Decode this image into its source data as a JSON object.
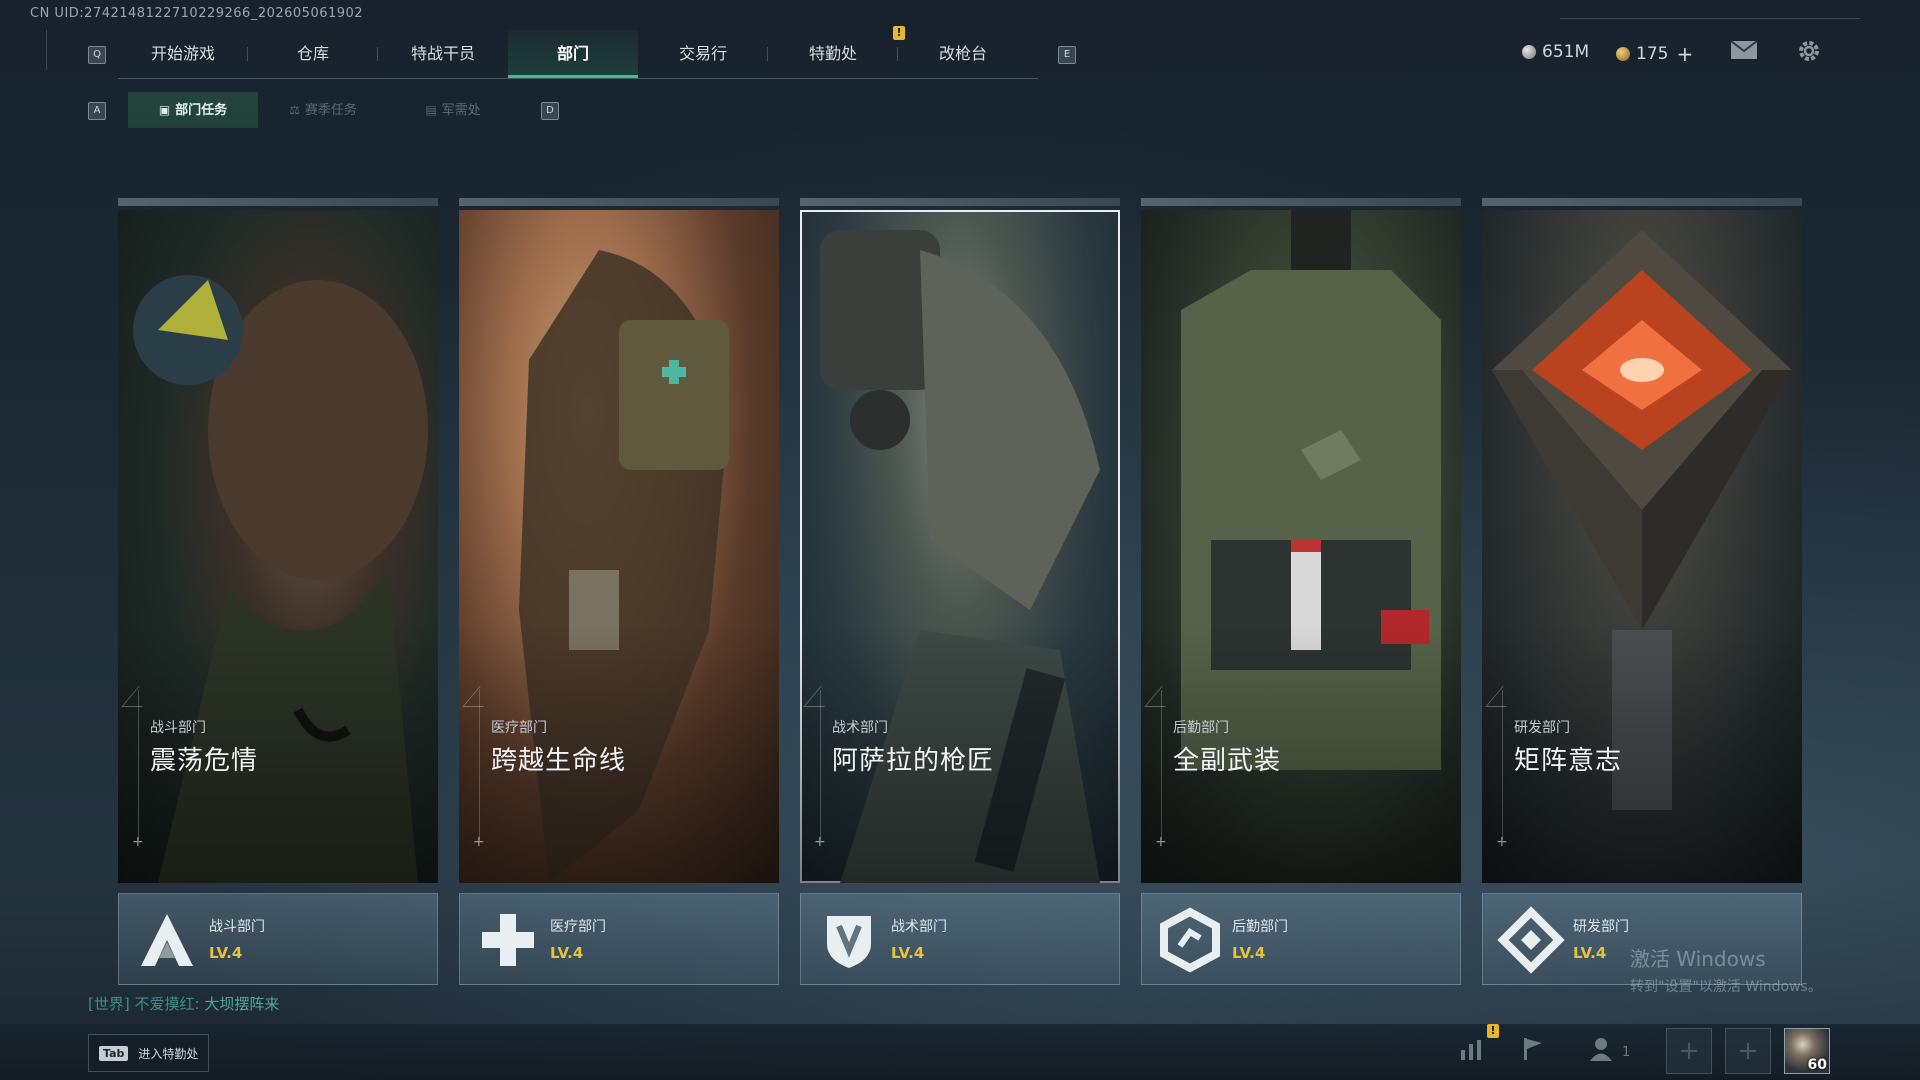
{
  "uid_text": "CN UID:2742148122710229266_202605061902",
  "nav": {
    "left_key": "Q",
    "right_key": "E",
    "tabs": [
      {
        "label": "开始游戏"
      },
      {
        "label": "仓库"
      },
      {
        "label": "特战干员"
      },
      {
        "label": "部门",
        "active": true
      },
      {
        "label": "交易行"
      },
      {
        "label": "特勤处"
      },
      {
        "label": "改枪台"
      }
    ],
    "alert_mark": "!"
  },
  "currency": {
    "silver_value": "651M",
    "gold_value": "175",
    "gold_plus": "+"
  },
  "subnav": {
    "left_key": "A",
    "right_key": "D",
    "tabs": [
      {
        "label": "部门任务",
        "active": true
      },
      {
        "label": "赛季任务"
      },
      {
        "label": "军需处"
      }
    ]
  },
  "cards": [
    {
      "category": "战斗部门",
      "title": "震荡危情",
      "dept_name": "战斗部门",
      "level": "LV.4",
      "emblem": "combat-emblem-icon"
    },
    {
      "category": "医疗部门",
      "title": "跨越生命线",
      "dept_name": "医疗部门",
      "level": "LV.4",
      "emblem": "medical-cross-icon"
    },
    {
      "category": "战术部门",
      "title": "阿萨拉的枪匠",
      "dept_name": "战术部门",
      "level": "LV.4",
      "emblem": "tactical-shield-icon",
      "selected": true
    },
    {
      "category": "后勤部门",
      "title": "全副武装",
      "dept_name": "后勤部门",
      "level": "LV.4",
      "emblem": "logistics-hexagon-icon"
    },
    {
      "category": "研发部门",
      "title": "矩阵意志",
      "dept_name": "研发部门",
      "level": "LV.4",
      "emblem": "research-diamond-icon"
    }
  ],
  "chat": {
    "channel": "[世界]",
    "sender": "不爱摸红:",
    "message": "大坝摆阵来"
  },
  "watermark": {
    "line1": "激活 Windows",
    "line2": "转到\"设置\"以激活 Windows。"
  },
  "bottom": {
    "tab_key": "Tab",
    "tab_label": "进入特勤处",
    "friends_count": "1",
    "player_level": "60",
    "slot_plus": "+"
  }
}
